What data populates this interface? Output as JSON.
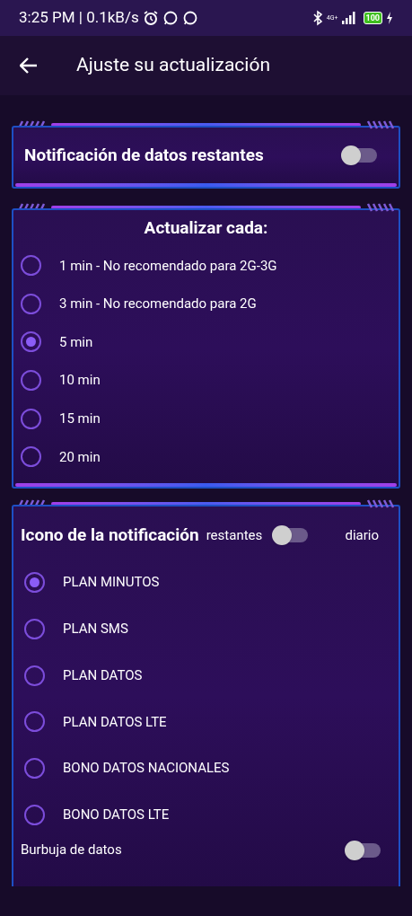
{
  "status_bar": {
    "time": "3:25 PM | 0.1kB/s",
    "network": "4G+",
    "battery": "100"
  },
  "header": {
    "title": "Ajuste su actualización"
  },
  "remaining_notification": {
    "label": "Notificación de datos restantes",
    "on": false
  },
  "update_interval": {
    "title": "Actualizar cada:",
    "options": [
      {
        "label": "1 min - No recomendado para 2G-3G",
        "selected": false
      },
      {
        "label": "3 min - No recomendado para 2G",
        "selected": false
      },
      {
        "label": "5 min",
        "selected": true
      },
      {
        "label": "10 min",
        "selected": false
      },
      {
        "label": "15 min",
        "selected": false
      },
      {
        "label": "20 min",
        "selected": false
      }
    ]
  },
  "notification_icon": {
    "title": "Icono de la notificación",
    "left_label": "restantes",
    "right_label": "diario",
    "on": false,
    "options": [
      {
        "label": "PLAN MINUTOS",
        "selected": true
      },
      {
        "label": "PLAN SMS",
        "selected": false
      },
      {
        "label": "PLAN DATOS",
        "selected": false
      },
      {
        "label": "PLAN DATOS LTE",
        "selected": false
      },
      {
        "label": "BONO DATOS NACIONALES",
        "selected": false
      },
      {
        "label": "BONO DATOS LTE",
        "selected": false
      }
    ],
    "bubble": {
      "label": "Burbuja de datos",
      "on": false
    }
  }
}
